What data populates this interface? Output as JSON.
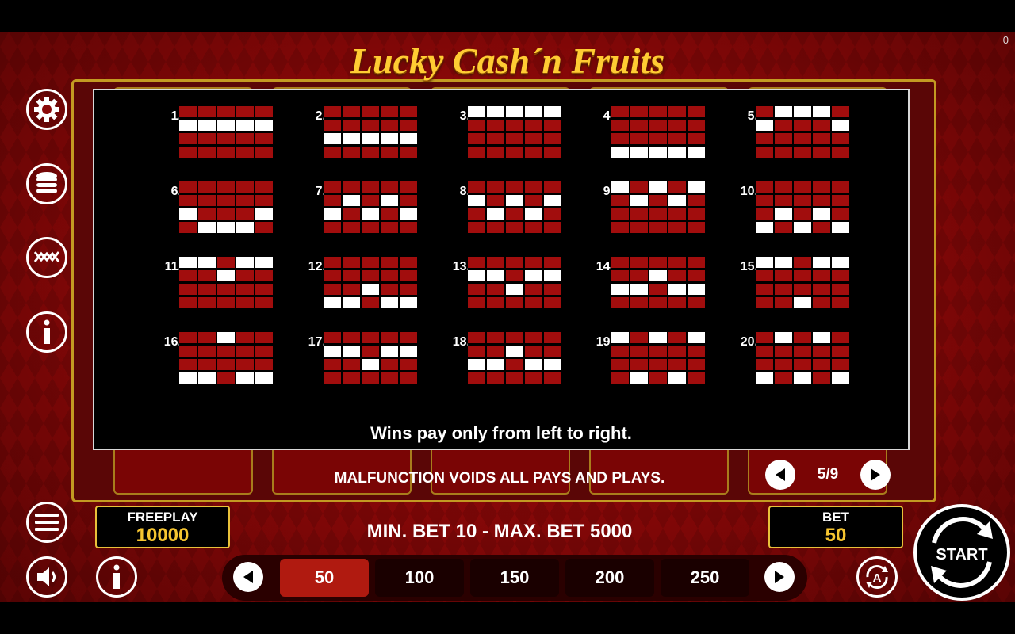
{
  "corner_counter": "0",
  "title": "Lucky Cash´n Fruits",
  "menu": {
    "settings_icon": "gear-icon",
    "coins_icon": "coin-stack-icon",
    "paylines_icon": "paylines-icon",
    "info_icon": "info-icon",
    "menu_icon": "hamburger-icon",
    "sound_icon": "speaker-icon"
  },
  "paytable": {
    "page_text": "5/9",
    "footer_text": "Wins pay only from left to right.",
    "lines": [
      {
        "num": "1.",
        "rows": [
          1,
          1,
          1,
          1,
          1
        ]
      },
      {
        "num": "2.",
        "rows": [
          2,
          2,
          2,
          2,
          2
        ]
      },
      {
        "num": "3.",
        "rows": [
          0,
          0,
          0,
          0,
          0
        ]
      },
      {
        "num": "4.",
        "rows": [
          3,
          3,
          3,
          3,
          3
        ]
      },
      {
        "num": "5.",
        "rows": [
          1,
          0,
          0,
          0,
          1
        ]
      },
      {
        "num": "6.",
        "rows": [
          2,
          3,
          3,
          3,
          2
        ]
      },
      {
        "num": "7.",
        "rows": [
          2,
          1,
          2,
          1,
          2
        ]
      },
      {
        "num": "8.",
        "rows": [
          1,
          2,
          1,
          2,
          1
        ]
      },
      {
        "num": "9.",
        "rows": [
          0,
          1,
          0,
          1,
          0
        ]
      },
      {
        "num": "10.",
        "rows": [
          3,
          2,
          3,
          2,
          3
        ]
      },
      {
        "num": "11.",
        "rows": [
          0,
          0,
          1,
          0,
          0
        ]
      },
      {
        "num": "12.",
        "rows": [
          3,
          3,
          2,
          3,
          3
        ]
      },
      {
        "num": "13.",
        "rows": [
          1,
          1,
          2,
          1,
          1
        ]
      },
      {
        "num": "14.",
        "rows": [
          2,
          2,
          1,
          2,
          2
        ]
      },
      {
        "num": "15.",
        "rows": [
          0,
          0,
          3,
          0,
          0
        ]
      },
      {
        "num": "16.",
        "rows": [
          3,
          3,
          0,
          3,
          3
        ]
      },
      {
        "num": "17.",
        "rows": [
          1,
          1,
          2,
          1,
          1
        ]
      },
      {
        "num": "18.",
        "rows": [
          2,
          2,
          1,
          2,
          2
        ]
      },
      {
        "num": "19.",
        "rows": [
          0,
          3,
          0,
          3,
          0
        ]
      },
      {
        "num": "20.",
        "rows": [
          3,
          0,
          3,
          0,
          3
        ]
      }
    ]
  },
  "notice": "MALFUNCTION VOIDS ALL PAYS AND PLAYS.",
  "freeplay": {
    "label": "FREEPLAY",
    "value": "10000"
  },
  "bet": {
    "label": "BET",
    "value": "50"
  },
  "bet_limits": "MIN. BET 10 - MAX. BET 5000",
  "bet_options": [
    "50",
    "100",
    "150",
    "200",
    "250"
  ],
  "selected_bet": "50",
  "start_label": "START",
  "autoplay_icon": "autoplay-icon"
}
